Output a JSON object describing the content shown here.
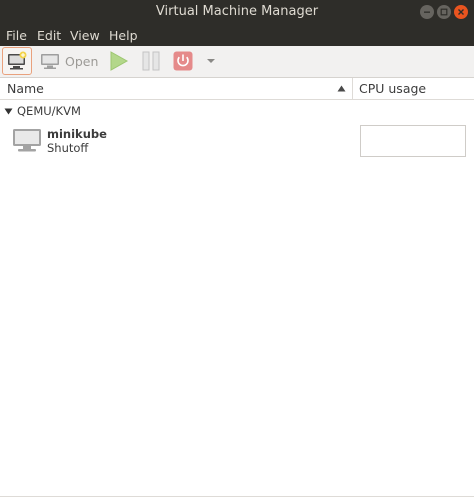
{
  "window": {
    "title": "Virtual Machine Manager"
  },
  "menubar": {
    "items": [
      {
        "label": "File"
      },
      {
        "label": "Edit"
      },
      {
        "label": "View"
      },
      {
        "label": "Help"
      }
    ]
  },
  "toolbar": {
    "open_label": "Open",
    "icons": [
      "new-vm-icon",
      "monitor-icon",
      "play-icon",
      "pause-icon",
      "power-icon",
      "dropdown-arrow-icon"
    ]
  },
  "columns": {
    "name": "Name",
    "cpu_usage": "CPU usage"
  },
  "tree": {
    "group_label": "QEMU/KVM",
    "vms": [
      {
        "name": "minikube",
        "status": "Shutoff"
      }
    ]
  },
  "colors": {
    "titlebar_bg": "#2e2d29",
    "close_button": "#e9541f",
    "play_green": "#a6cf6a",
    "power_red": "#e16a6a"
  }
}
